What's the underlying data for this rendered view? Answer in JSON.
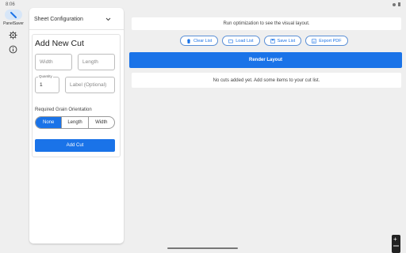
{
  "status": {
    "time": "8:06"
  },
  "rail": {
    "app_name": "PanelSaver"
  },
  "sidebar": {
    "sheet_config_label": "Sheet Configuration"
  },
  "add_cut": {
    "title": "Add New Cut",
    "width_placeholder": "Width",
    "length_placeholder": "Length",
    "quantity_label": "Quantity",
    "quantity_value": "1",
    "label_placeholder": "Label (Optional)",
    "grain_label": "Required Grain Orientation",
    "grain_options": [
      "None",
      "Length",
      "Width"
    ],
    "grain_selected": "None",
    "add_button": "Add Cut"
  },
  "main": {
    "message": "Run optimization to see the visual layout.",
    "tools": [
      "Clear List",
      "Load List",
      "Save List",
      "Export PDF"
    ],
    "render_button": "Render Layout",
    "empty_message": "No cuts added yet. Add some items to your cut list."
  },
  "colors": {
    "accent": "#1a73e8"
  }
}
